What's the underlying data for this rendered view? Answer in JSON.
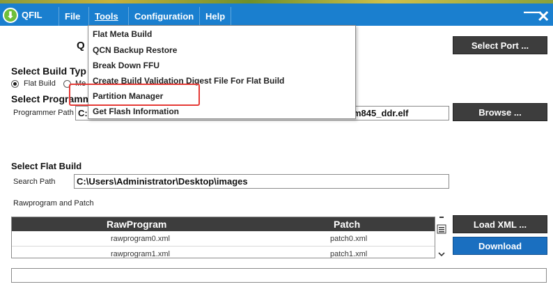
{
  "window": {
    "title": "QFIL",
    "close_glyph": "✕",
    "minimize_glyph": "—"
  },
  "menu": [
    {
      "label": "File"
    },
    {
      "label": "Tools"
    },
    {
      "label": "Configuration"
    },
    {
      "label": "Help"
    }
  ],
  "tools_menu": {
    "items": [
      "Flat Meta Build",
      "QCN Backup Restore",
      "Break Down FFU",
      "Create Build Validation Digest File For Flat Build",
      "Partition Manager",
      "Get Flash Information"
    ],
    "highlighted": "Partition Manager"
  },
  "port": {
    "title_visible": "Q",
    "select_label": "Select Port ..."
  },
  "build_type": {
    "heading": "Select Build Typ",
    "option_flat": "Flat Build",
    "option_meta_partial": "Me",
    "selected": "Flat Build"
  },
  "programmer": {
    "heading": "Select Programm",
    "label": "Programmer Path",
    "value_prefix": "C:\\",
    "value_suffix": "m845_ddr.elf",
    "browse_label": "Browse ..."
  },
  "flat_build": {
    "heading": "Select Flat Build",
    "search_label": "Search Path",
    "search_value": "C:\\Users\\Administrator\\Desktop\\images",
    "rawprogram_label": "Rawprogram and Patch",
    "load_xml_label": "Load XML ...",
    "download_label": "Download"
  },
  "table": {
    "headers": [
      "RawProgram",
      "Patch"
    ],
    "rows": [
      [
        "rawprogram0.xml",
        "patch0.xml"
      ],
      [
        "rawprogram1.xml",
        "patch1.xml"
      ]
    ]
  },
  "colors": {
    "title_bar": "#1a7fcf",
    "button_dark": "#3d3d3d",
    "button_blue": "#1a6fc0",
    "highlight_box": "#e53935"
  }
}
